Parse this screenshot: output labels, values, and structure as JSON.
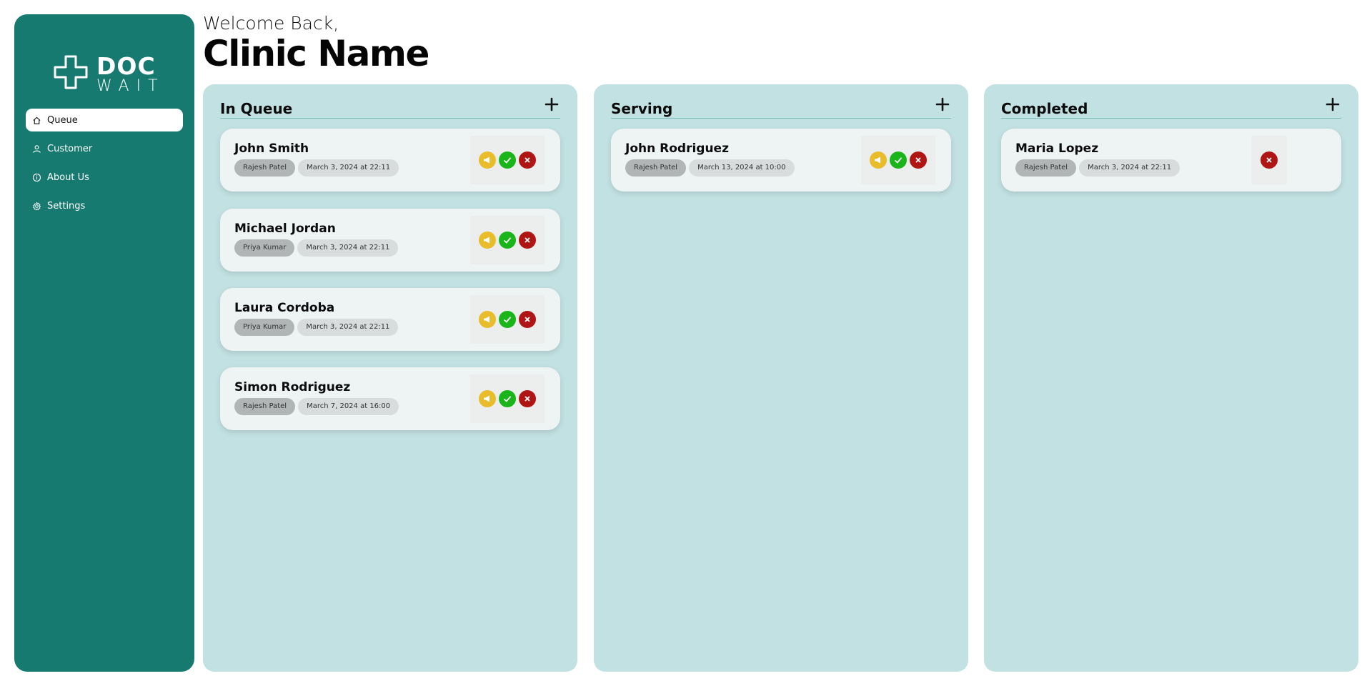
{
  "app": {
    "brand_top": "DOC",
    "brand_bottom": "WAIT"
  },
  "sidebar": {
    "items": [
      {
        "label": "Queue",
        "icon": "home-icon",
        "active": true
      },
      {
        "label": "Customer",
        "icon": "user-icon",
        "active": false
      },
      {
        "label": "About Us",
        "icon": "info-icon",
        "active": false
      },
      {
        "label": "Settings",
        "icon": "gear-icon",
        "active": false
      }
    ]
  },
  "header": {
    "greeting": "Welcome Back,",
    "clinic_name": "Clinic Name"
  },
  "columns": [
    {
      "title": "In Queue",
      "cards": [
        {
          "name": "John Smith",
          "doctor": "Rajesh Patel",
          "date": "March 3, 2024 at 22:11"
        },
        {
          "name": "Michael Jordan",
          "doctor": "Priya Kumar",
          "date": "March 3, 2024 at 22:11"
        },
        {
          "name": "Laura Cordoba",
          "doctor": "Priya Kumar",
          "date": "March 3, 2024 at 22:11"
        },
        {
          "name": "Simon Rodriguez",
          "doctor": "Rajesh Patel",
          "date": "March 7, 2024 at 16:00"
        }
      ]
    },
    {
      "title": "Serving",
      "cards": [
        {
          "name": "John Rodriguez",
          "doctor": "Rajesh Patel",
          "date": "March 13, 2024 at 10:00"
        }
      ]
    },
    {
      "title": "Completed",
      "cards": [
        {
          "name": "Maria Lopez",
          "doctor": "Rajesh Patel",
          "date": "March 3, 2024 at 22:11"
        }
      ]
    }
  ],
  "colors": {
    "sidebar": "#177a70",
    "column_bg": "#c2e1e2",
    "call": "#e8bc2a",
    "done": "#1ab51a",
    "cancel": "#b01515"
  }
}
